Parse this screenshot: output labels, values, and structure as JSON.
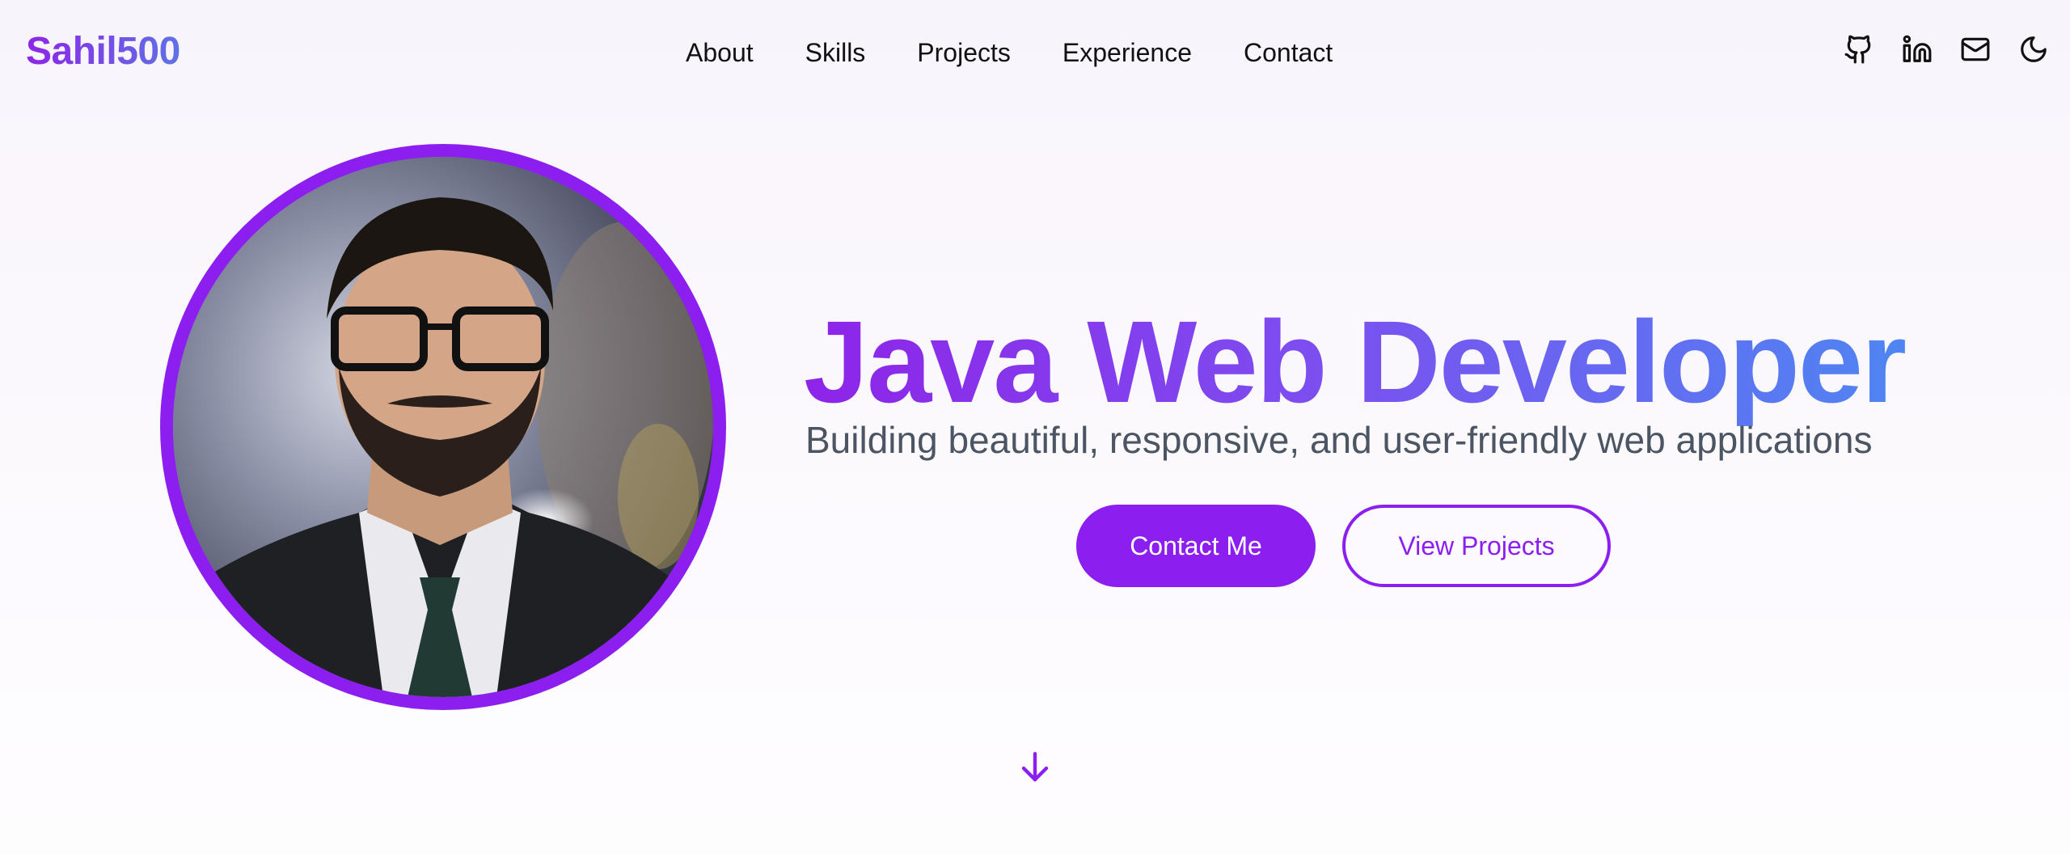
{
  "header": {
    "brand": "Sahil500",
    "nav": {
      "about": "About",
      "skills": "Skills",
      "projects": "Projects",
      "experience": "Experience",
      "contact": "Contact"
    },
    "icons": [
      "github-icon",
      "linkedin-icon",
      "mail-icon",
      "moon-icon"
    ]
  },
  "hero": {
    "title": "Java Web Developer",
    "subtitle": "Building beautiful, responsive, and user-friendly web applications",
    "primary_button": "Contact Me",
    "secondary_button": "View Projects"
  },
  "colors": {
    "accent": "#8c1ff0",
    "gradient_end": "#4f85f2",
    "subtitle_text": "#4b5563"
  }
}
